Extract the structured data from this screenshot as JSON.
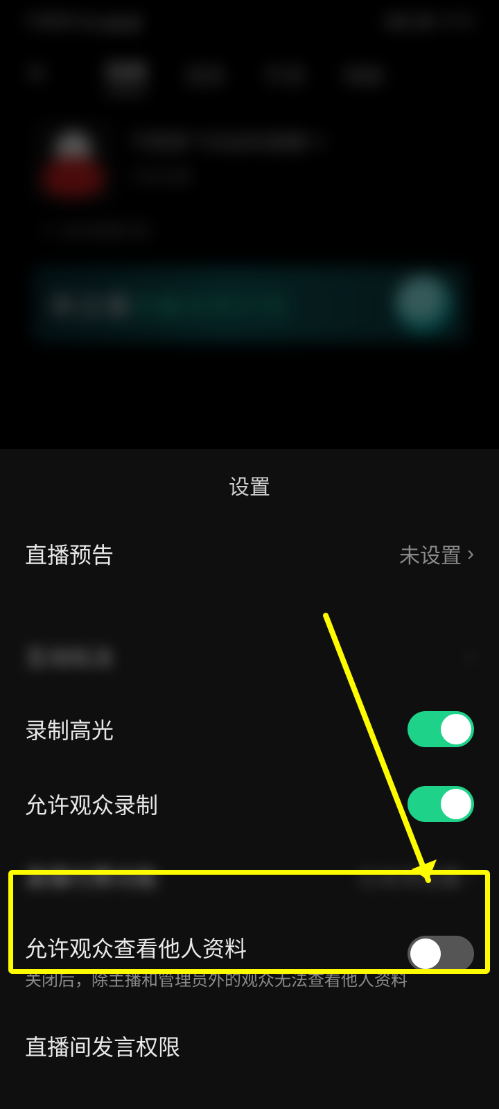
{
  "statusbar": {
    "left": "中国移动 ▮ ◢ ◢",
    "right": "▮ ◧ ▣ 10:36"
  },
  "tabs": {
    "t1": "视频",
    "t2": "语音",
    "t3": "手游",
    "t4": "电脑"
  },
  "profile": {
    "name": "不愿意飞鸟店的直播 ✎",
    "sub": "开始设置",
    "subline": "◎ 当前直播内容"
  },
  "banner": {
    "a": "新主播",
    "b": "流量扶持计划"
  },
  "sheet": {
    "title": "设置",
    "row_forecast": {
      "label": "直播预告",
      "value": "未设置"
    },
    "row_hidden1": {
      "label": "互动玩法"
    },
    "row_record": {
      "label": "录制高光"
    },
    "row_allowrec": {
      "label": "允许观众录制"
    },
    "row_hidden2": {
      "label": "直播付费功能",
      "value": "已关闭设置"
    },
    "row_viewinfo": {
      "label": "允许观众查看他人资料",
      "sub": "关闭后，除主播和管理员外的观众无法查看他人资料"
    },
    "row_speak": {
      "label": "直播间发言权限"
    }
  },
  "toggles": {
    "record": true,
    "allowrec": true,
    "viewinfo": false
  },
  "colors": {
    "toggle_on": "#1fd28a",
    "highlight": "#fffb00"
  }
}
